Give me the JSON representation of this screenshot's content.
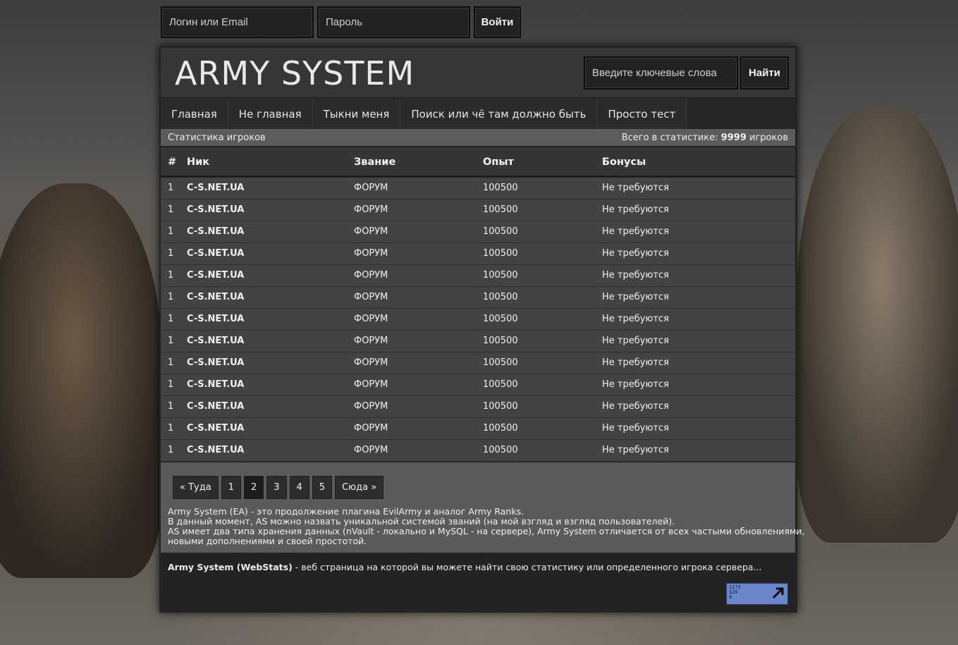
{
  "login": {
    "login_placeholder": "Логин или Email",
    "password_placeholder": "Пароль",
    "submit_label": "Войти"
  },
  "header": {
    "logo": "ARMY SYSTEM",
    "search_placeholder": "Введите ключевые слова",
    "search_button": "Найти"
  },
  "nav": {
    "items": [
      {
        "label": "Главная"
      },
      {
        "label": "Не главная"
      },
      {
        "label": "Тыкни меня"
      },
      {
        "label": "Поиск или чё там должно быть"
      },
      {
        "label": "Просто тест"
      }
    ]
  },
  "stats": {
    "title": "Статистика игроков",
    "total_prefix": "Всего в статистике:",
    "total_count": "9999",
    "total_suffix": "игроков"
  },
  "table": {
    "headers": {
      "num": "#",
      "nick": "Ник",
      "rank": "Звание",
      "xp": "Опыт",
      "bonus": "Бонусы"
    },
    "rows": [
      {
        "num": "1",
        "nick": "C-S.NET.UA",
        "rank": "ФОРУМ",
        "xp": "100500",
        "bonus": "Не требуются"
      },
      {
        "num": "1",
        "nick": "C-S.NET.UA",
        "rank": "ФОРУМ",
        "xp": "100500",
        "bonus": "Не требуются"
      },
      {
        "num": "1",
        "nick": "C-S.NET.UA",
        "rank": "ФОРУМ",
        "xp": "100500",
        "bonus": "Не требуются"
      },
      {
        "num": "1",
        "nick": "C-S.NET.UA",
        "rank": "ФОРУМ",
        "xp": "100500",
        "bonus": "Не требуются"
      },
      {
        "num": "1",
        "nick": "C-S.NET.UA",
        "rank": "ФОРУМ",
        "xp": "100500",
        "bonus": "Не требуются"
      },
      {
        "num": "1",
        "nick": "C-S.NET.UA",
        "rank": "ФОРУМ",
        "xp": "100500",
        "bonus": "Не требуются"
      },
      {
        "num": "1",
        "nick": "C-S.NET.UA",
        "rank": "ФОРУМ",
        "xp": "100500",
        "bonus": "Не требуются"
      },
      {
        "num": "1",
        "nick": "C-S.NET.UA",
        "rank": "ФОРУМ",
        "xp": "100500",
        "bonus": "Не требуются"
      },
      {
        "num": "1",
        "nick": "C-S.NET.UA",
        "rank": "ФОРУМ",
        "xp": "100500",
        "bonus": "Не требуются"
      },
      {
        "num": "1",
        "nick": "C-S.NET.UA",
        "rank": "ФОРУМ",
        "xp": "100500",
        "bonus": "Не требуются"
      },
      {
        "num": "1",
        "nick": "C-S.NET.UA",
        "rank": "ФОРУМ",
        "xp": "100500",
        "bonus": "Не требуются"
      },
      {
        "num": "1",
        "nick": "C-S.NET.UA",
        "rank": "ФОРУМ",
        "xp": "100500",
        "bonus": "Не требуются"
      },
      {
        "num": "1",
        "nick": "C-S.NET.UA",
        "rank": "ФОРУМ",
        "xp": "100500",
        "bonus": "Не требуются"
      }
    ]
  },
  "pagination": {
    "prev": "« Туда",
    "pages": [
      "1",
      "2",
      "3",
      "4",
      "5"
    ],
    "active_page": "2",
    "next": "Сюда »"
  },
  "about": {
    "lines": [
      "Army System (EA) - это продолжение плагина EvilArmy и аналог Army Ranks.",
      "В данный момент, AS можно назвать уникальной системой званий (на мой взгляд и взгляд пользователей).",
      "AS имеет два типа хранения данных (nVault - локально и MySQL - на сервере), Army System отличается от всех частыми обновлениями,",
      "новыми дополнениями и своей простотой."
    ]
  },
  "footer": {
    "strong": "Army System (WebStats)",
    "text": " - веб страница на которой вы можете найти свою статистику или определенного игрока сервера...",
    "counter_lines": [
      "1173",
      "125",
      "4"
    ],
    "counter_icon": "arrow-up-right-icon"
  },
  "colors": {
    "panel_bg": "#232323",
    "row_bg": "#434343",
    "stats_bar_bg": "#5c5c5c",
    "counter_bg": "#6b86c9"
  }
}
